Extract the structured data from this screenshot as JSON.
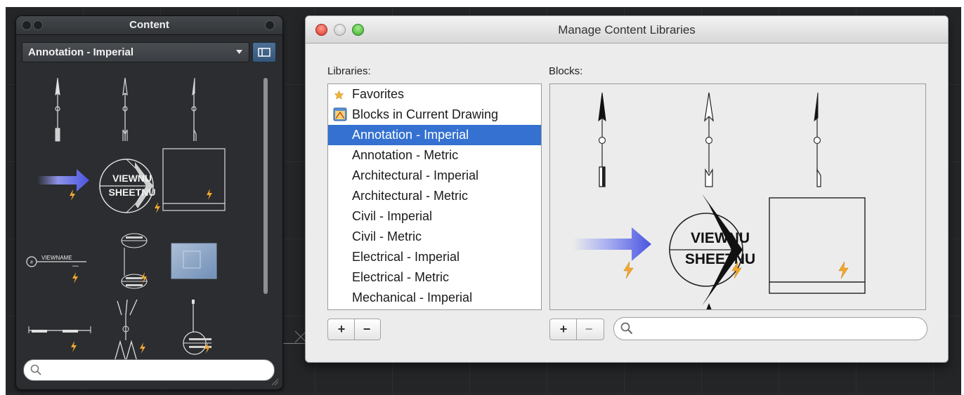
{
  "palette": {
    "title": "Content",
    "library_select": "Annotation - Imperial"
  },
  "dialog": {
    "title": "Manage Content Libraries",
    "libraries_label": "Libraries:",
    "blocks_label": "Blocks:",
    "libraries": [
      {
        "label": "Favorites",
        "icon": "star-icon"
      },
      {
        "label": "Blocks in Current Drawing",
        "icon": "drawing-blocks-icon"
      },
      {
        "label": "Annotation - Imperial",
        "selected": true
      },
      {
        "label": "Annotation - Metric"
      },
      {
        "label": "Architectural - Imperial"
      },
      {
        "label": "Architectural - Metric"
      },
      {
        "label": "Civil - Imperial"
      },
      {
        "label": "Civil - Metric"
      },
      {
        "label": "Electrical - Imperial"
      },
      {
        "label": "Electrical - Metric"
      },
      {
        "label": "Mechanical - Imperial"
      }
    ],
    "add_label": "+",
    "remove_label": "−",
    "block_texts": {
      "view": "VIEWNU",
      "sheet": "SHEETNU"
    }
  },
  "palette_block_texts": {
    "view": "VIEWNU",
    "sheet": "SHEETNU",
    "viewname": "VIEWNAME"
  },
  "colors": {
    "selection": "#3471d0",
    "dynamic_bolt": "#f0a830",
    "arrow_blue": "#4a55e0"
  }
}
